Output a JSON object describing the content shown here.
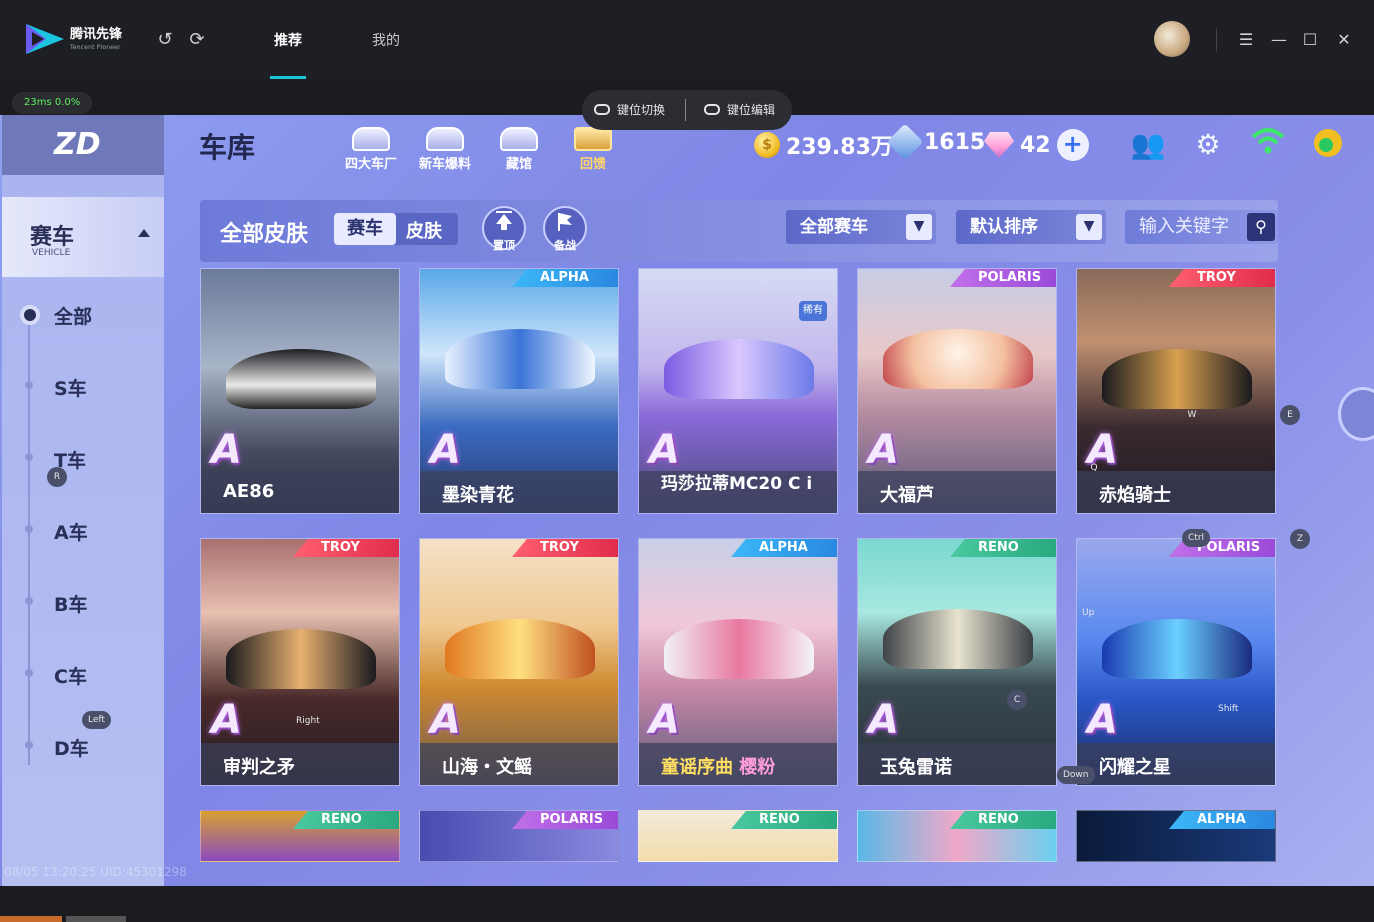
{
  "titlebar": {
    "logo_text": "腾讯先锋",
    "logo_sub": "Tencent Pioneer",
    "tabs": [
      {
        "label": "推荐",
        "active": true
      },
      {
        "label": "我的",
        "active": false
      }
    ],
    "icons": {
      "back": "undo-icon",
      "refresh": "refresh-icon",
      "menu": "menu-icon",
      "min": "minimize-icon",
      "max": "maximize-icon",
      "close": "close-icon"
    }
  },
  "status": {
    "ping": "23ms",
    "loss": "0.0%"
  },
  "keymap": {
    "switch_label": "键位切换",
    "edit_label": "键位编辑"
  },
  "game": {
    "page_title": "车库",
    "nav": [
      {
        "label": "四大车厂"
      },
      {
        "label": "新车爆料"
      },
      {
        "label": "藏馆"
      },
      {
        "label": "回馈"
      }
    ],
    "currency": {
      "coins": "239.83万",
      "gems": "1615",
      "diamonds": "42"
    },
    "sidebar": {
      "category_title": "赛车",
      "category_sub": "VEHICLE",
      "classes": [
        "全部",
        "S车",
        "T车",
        "A车",
        "B车",
        "C车",
        "D车"
      ],
      "active_class": "全部"
    },
    "filter": {
      "title": "全部皮肤",
      "segments": [
        "赛车",
        "皮肤"
      ],
      "pin_label": "置顶",
      "battle_label": "备战",
      "car_filter": "全部赛车",
      "sort": "默认排序",
      "search_placeholder": "输入关键字"
    },
    "cars": [
      {
        "name": "AE86",
        "grade": "A",
        "brand": ""
      },
      {
        "name": "墨染青花",
        "grade": "A",
        "brand": "ALPHA"
      },
      {
        "name": "玛莎拉蒂MC20 C i",
        "grade": "A",
        "brand": ""
      },
      {
        "name": "大福芦",
        "grade": "A",
        "brand": "POLARIS"
      },
      {
        "name": "赤焰骑士",
        "grade": "A",
        "brand": "TROY"
      },
      {
        "name": "审判之矛",
        "grade": "A",
        "brand": "TROY"
      },
      {
        "name": "山海・文鳐",
        "grade": "A",
        "brand": "TROY"
      },
      {
        "name": "童谣序曲",
        "sub": "樱粉",
        "grade": "A",
        "brand": "ALPHA"
      },
      {
        "name": "玉兔雷诺",
        "grade": "A",
        "brand": "RENO"
      },
      {
        "name": "闪耀之星",
        "grade": "A",
        "brand": "POLARIS"
      }
    ],
    "partial_brands": [
      "RENO",
      "POLARIS",
      "RENO",
      "RENO",
      "ALPHA"
    ],
    "tag_rare": "稀有",
    "key_overlays": {
      "E": "E",
      "Z": "Z",
      "R": "R",
      "Q": "Q",
      "W": "W",
      "Ctrl": "Ctrl",
      "Up": "Up",
      "Shift": "Shift",
      "Right": "Right",
      "Left": "Left",
      "Down": "Down",
      "C": "C"
    }
  },
  "footer": {
    "watermark": "08/05 13:20:25 UID:45301298"
  }
}
